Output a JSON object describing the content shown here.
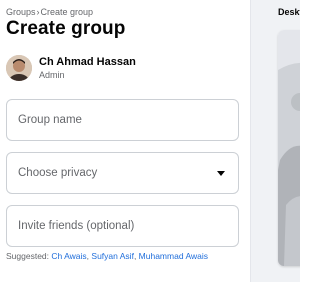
{
  "breadcrumb": {
    "parent": "Groups",
    "separator": "›",
    "current": "Create group"
  },
  "page_title": "Create group",
  "admin": {
    "name": "Ch Ahmad Hassan",
    "role": "Admin"
  },
  "form": {
    "group_name_placeholder": "Group name",
    "privacy_placeholder": "Choose privacy",
    "invite_placeholder": "Invite friends (optional)"
  },
  "suggested": {
    "label": "Suggested:",
    "friends": [
      "Ch Awais",
      "Sufyan Asif",
      "Muhammad Awais"
    ],
    "separator": ", "
  },
  "preview": {
    "label": "Desktop preview"
  },
  "icons": {
    "privacy_dropdown": "caret-down-icon",
    "avatar": "avatar"
  },
  "colors": {
    "link": "#216fdb",
    "muted_text": "#65676b",
    "border": "#ccd0d5",
    "background_gray": "#f0f2f5"
  }
}
